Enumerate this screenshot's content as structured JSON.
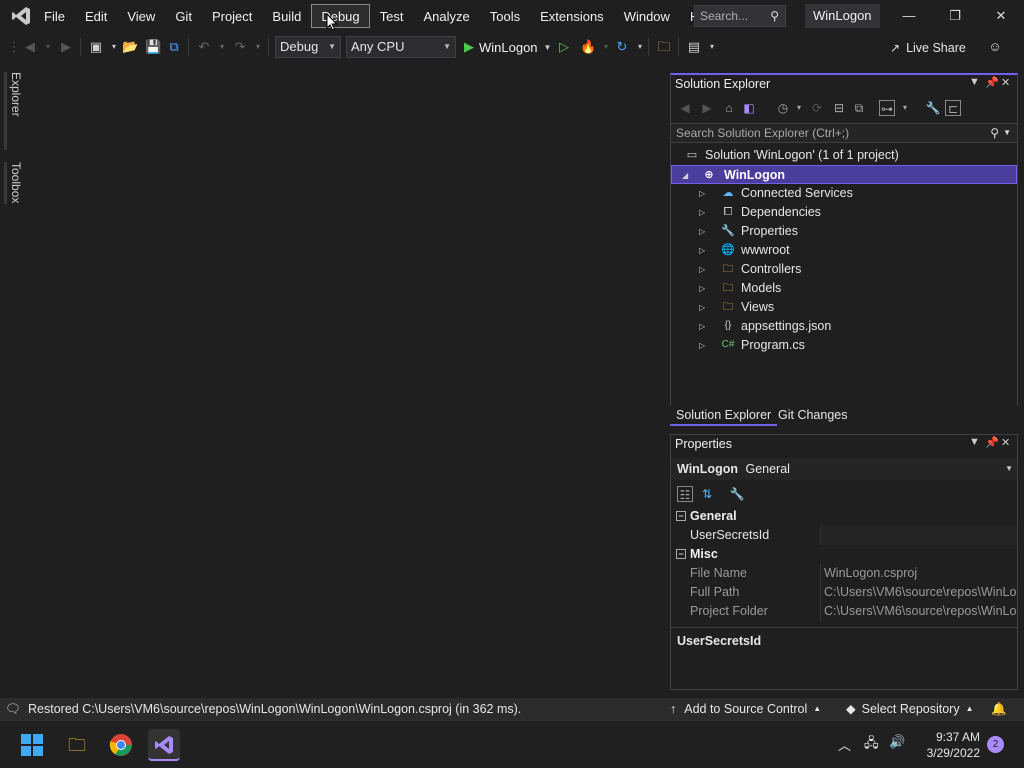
{
  "menubar": {
    "items": [
      "File",
      "Edit",
      "View",
      "Git",
      "Project",
      "Build",
      "Debug",
      "Test",
      "Analyze",
      "Tools",
      "Extensions",
      "Window",
      "Help"
    ],
    "search_placeholder": "Search...",
    "solution_name": "WinLogon",
    "window_controls": {
      "minimize": "—",
      "restore": "❐",
      "close": "✕"
    }
  },
  "toolbar": {
    "config": "Debug",
    "platform": "Any CPU",
    "run_target": "WinLogon",
    "live_share": "Live Share"
  },
  "left_tabs": [
    "Server Explorer",
    "Toolbox"
  ],
  "solution_explorer": {
    "title": "Solution Explorer",
    "search_placeholder": "Search Solution Explorer (Ctrl+;)",
    "solution_label": "Solution 'WinLogon' (1 of 1 project)",
    "project": "WinLogon",
    "items": [
      {
        "label": "Connected Services",
        "icon": "connected-services-icon"
      },
      {
        "label": "Dependencies",
        "icon": "dependencies-icon"
      },
      {
        "label": "Properties",
        "icon": "properties-icon"
      },
      {
        "label": "wwwroot",
        "icon": "globe-icon"
      },
      {
        "label": "Controllers",
        "icon": "folder-icon"
      },
      {
        "label": "Models",
        "icon": "folder-icon"
      },
      {
        "label": "Views",
        "icon": "folder-icon"
      },
      {
        "label": "appsettings.json",
        "icon": "json-file-icon"
      },
      {
        "label": "Program.cs",
        "icon": "csharp-file-icon"
      }
    ],
    "tabs": [
      "Solution Explorer",
      "Git Changes"
    ]
  },
  "properties": {
    "title": "Properties",
    "object_name": "WinLogon",
    "object_type": "General",
    "categories": [
      {
        "name": "General",
        "rows": [
          {
            "name": "UserSecretsId",
            "value": ""
          }
        ]
      },
      {
        "name": "Misc",
        "rows": [
          {
            "name": "File Name",
            "value": "WinLogon.csproj"
          },
          {
            "name": "Full Path",
            "value": "C:\\Users\\VM6\\source\\repos\\WinLog"
          },
          {
            "name": "Project Folder",
            "value": "C:\\Users\\VM6\\source\\repos\\WinLog"
          }
        ]
      }
    ],
    "description_title": "UserSecretsId"
  },
  "statusbar": {
    "message": "Restored C:\\Users\\VM6\\source\\repos\\WinLogon\\WinLogon\\WinLogon.csproj (in 362 ms).",
    "source_control": "Add to Source Control",
    "repository": "Select Repository"
  },
  "taskbar": {
    "time": "9:37 AM",
    "date": "3/29/2022",
    "notification_count": "2"
  },
  "colors": {
    "accent": "#7160e8",
    "selection": "#4a3d9b",
    "run_green": "#4ec94e"
  }
}
